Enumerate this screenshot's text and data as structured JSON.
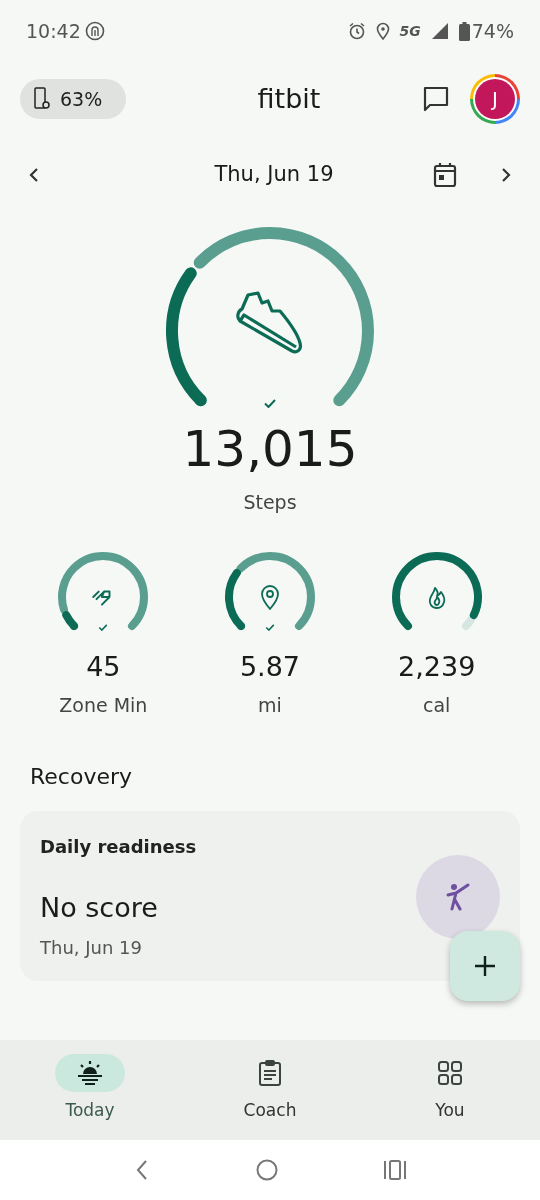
{
  "status_bar": {
    "time": "10:42",
    "network": "5G",
    "battery": "74%"
  },
  "header": {
    "device_battery": "63%",
    "title": "fitbit",
    "avatar": "J"
  },
  "date_nav": {
    "date": "Thu, Jun 19"
  },
  "steps": {
    "kind": "steps",
    "value": "13,015",
    "label": "Steps",
    "goal_met": true
  },
  "stats": [
    {
      "kind": "zone",
      "value": "45",
      "label": "Zone Min",
      "goal_met": true
    },
    {
      "kind": "distance",
      "value": "5.87",
      "label": "mi",
      "goal_met": true
    },
    {
      "kind": "calories",
      "value": "2,239",
      "label": "cal",
      "goal_met": false
    }
  ],
  "section_title": "Recovery",
  "card": {
    "title": "Daily readiness",
    "score": "No score",
    "date": "Thu, Jun 19"
  },
  "bottom_nav": [
    {
      "label": "Today",
      "kind": "today",
      "selected": true
    },
    {
      "label": "Coach",
      "kind": "coach",
      "selected": false
    },
    {
      "label": "You",
      "kind": "you",
      "selected": false
    }
  ]
}
